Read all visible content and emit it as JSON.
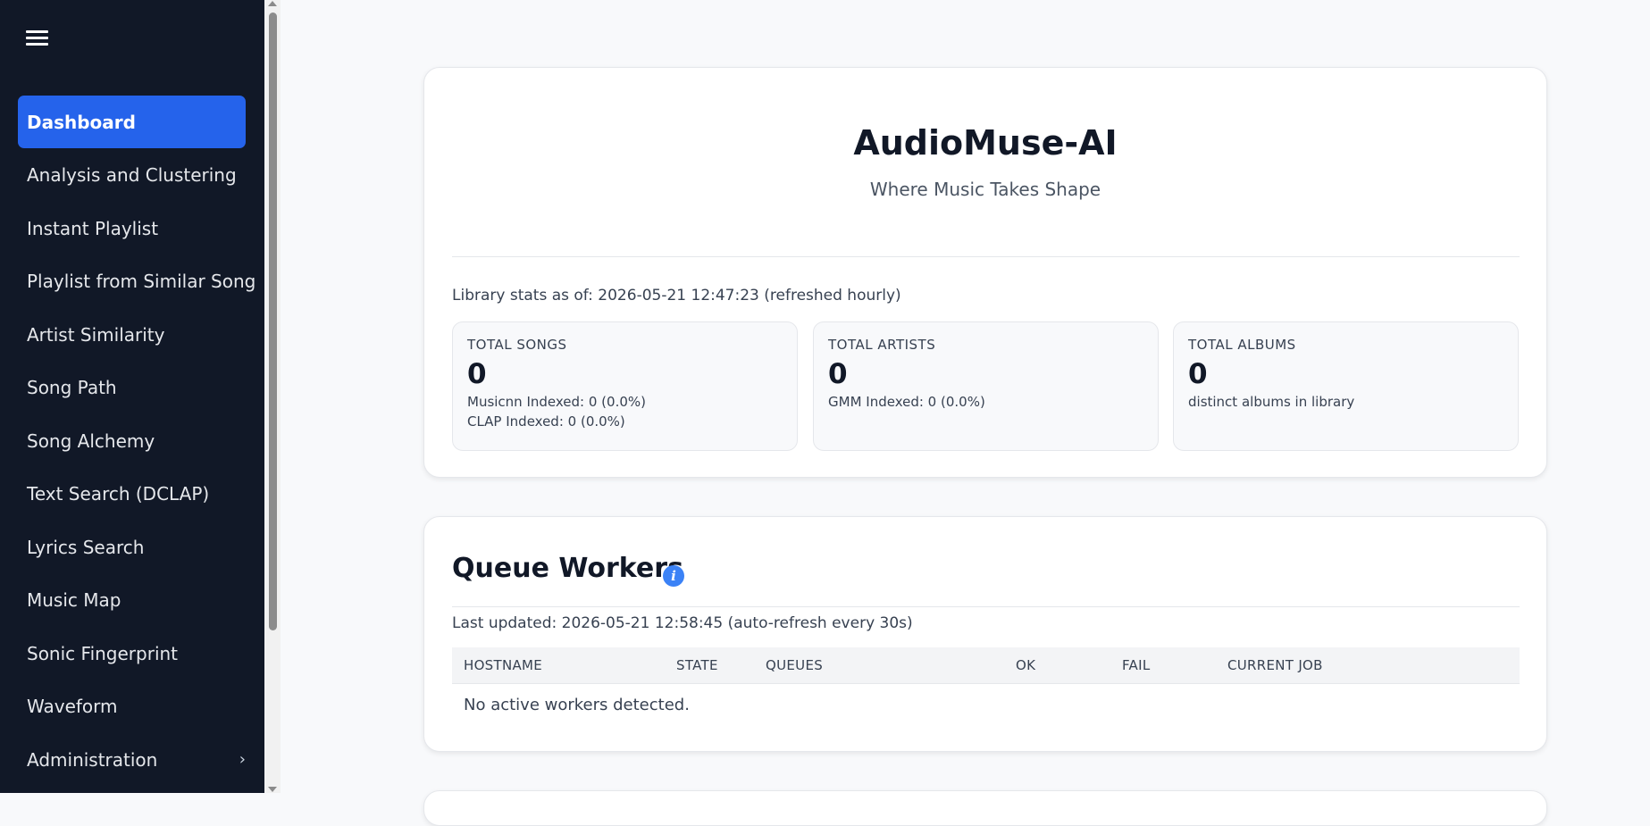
{
  "sidebar": {
    "menu_icon": "hamburger-menu-icon",
    "items": [
      {
        "label": "Dashboard",
        "active": true
      },
      {
        "label": "Analysis and Clustering"
      },
      {
        "label": "Instant Playlist"
      },
      {
        "label": "Playlist from Similar Song"
      },
      {
        "label": "Artist Similarity"
      },
      {
        "label": "Song Path"
      },
      {
        "label": "Song Alchemy"
      },
      {
        "label": "Text Search (DCLAP)"
      },
      {
        "label": "Lyrics Search"
      },
      {
        "label": "Music Map"
      },
      {
        "label": "Sonic Fingerprint"
      },
      {
        "label": "Waveform"
      },
      {
        "label": "Administration",
        "chevron": "›"
      }
    ]
  },
  "hero": {
    "title": "AudioMuse-AI",
    "subtitle": "Where Music Takes Shape",
    "stats_as_of": "Library stats as of: 2026-05-21 12:47:23 (refreshed hourly)",
    "stats": [
      {
        "label": "TOTAL SONGS",
        "value": "0",
        "sub": [
          "Musicnn Indexed: 0 (0.0%)",
          "CLAP Indexed: 0 (0.0%)"
        ]
      },
      {
        "label": "TOTAL ARTISTS",
        "value": "0",
        "sub": [
          "GMM Indexed: 0 (0.0%)"
        ]
      },
      {
        "label": "TOTAL ALBUMS",
        "value": "0",
        "sub": [
          "distinct albums in library"
        ]
      }
    ]
  },
  "queue": {
    "title": "Queue Workers",
    "info_icon": "info-icon",
    "last_updated": "Last updated: 2026-05-21 12:58:45 (auto-refresh every 30s)",
    "columns": [
      "HOSTNAME",
      "STATE",
      "QUEUES",
      "OK",
      "FAIL",
      "CURRENT JOB"
    ],
    "empty_message": "No active workers detected."
  },
  "colors": {
    "sidebar_bg": "#111827",
    "active_item": "#2563eb",
    "info_icon": "#3b82f6",
    "page_bg": "#f8f9fb"
  }
}
